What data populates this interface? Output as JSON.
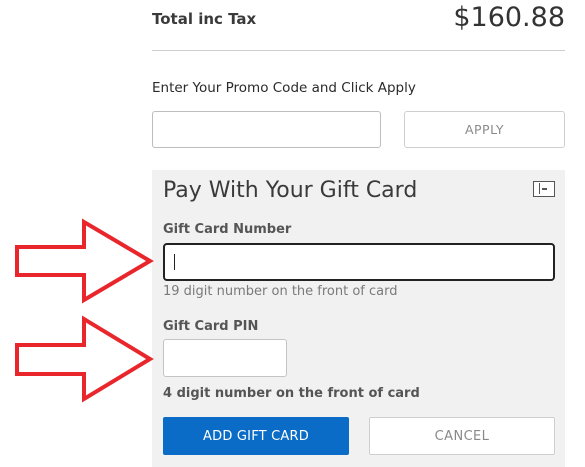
{
  "summary": {
    "total_label": "Total inc Tax",
    "total_value": "$160.88"
  },
  "promo": {
    "label": "Enter Your Promo Code and Click Apply",
    "input_value": "",
    "apply_label": "APPLY"
  },
  "gift_card": {
    "title": "Pay With Your Gift Card",
    "collapse_icon": "collapse-panel-icon",
    "number_label": "Gift Card Number",
    "number_value": "",
    "number_hint": "19 digit number on the front of card",
    "pin_label": "Gift Card PIN",
    "pin_value": "",
    "pin_hint": "4 digit number on the front of card",
    "add_label": "ADD GIFT CARD",
    "cancel_label": "CANCEL"
  },
  "annotations": {
    "arrow_color": "#e8262b",
    "arrow_icon": "red-arrow-icon"
  },
  "colors": {
    "primary_button": "#0a6cc7",
    "panel_background": "#f1f1f1"
  }
}
